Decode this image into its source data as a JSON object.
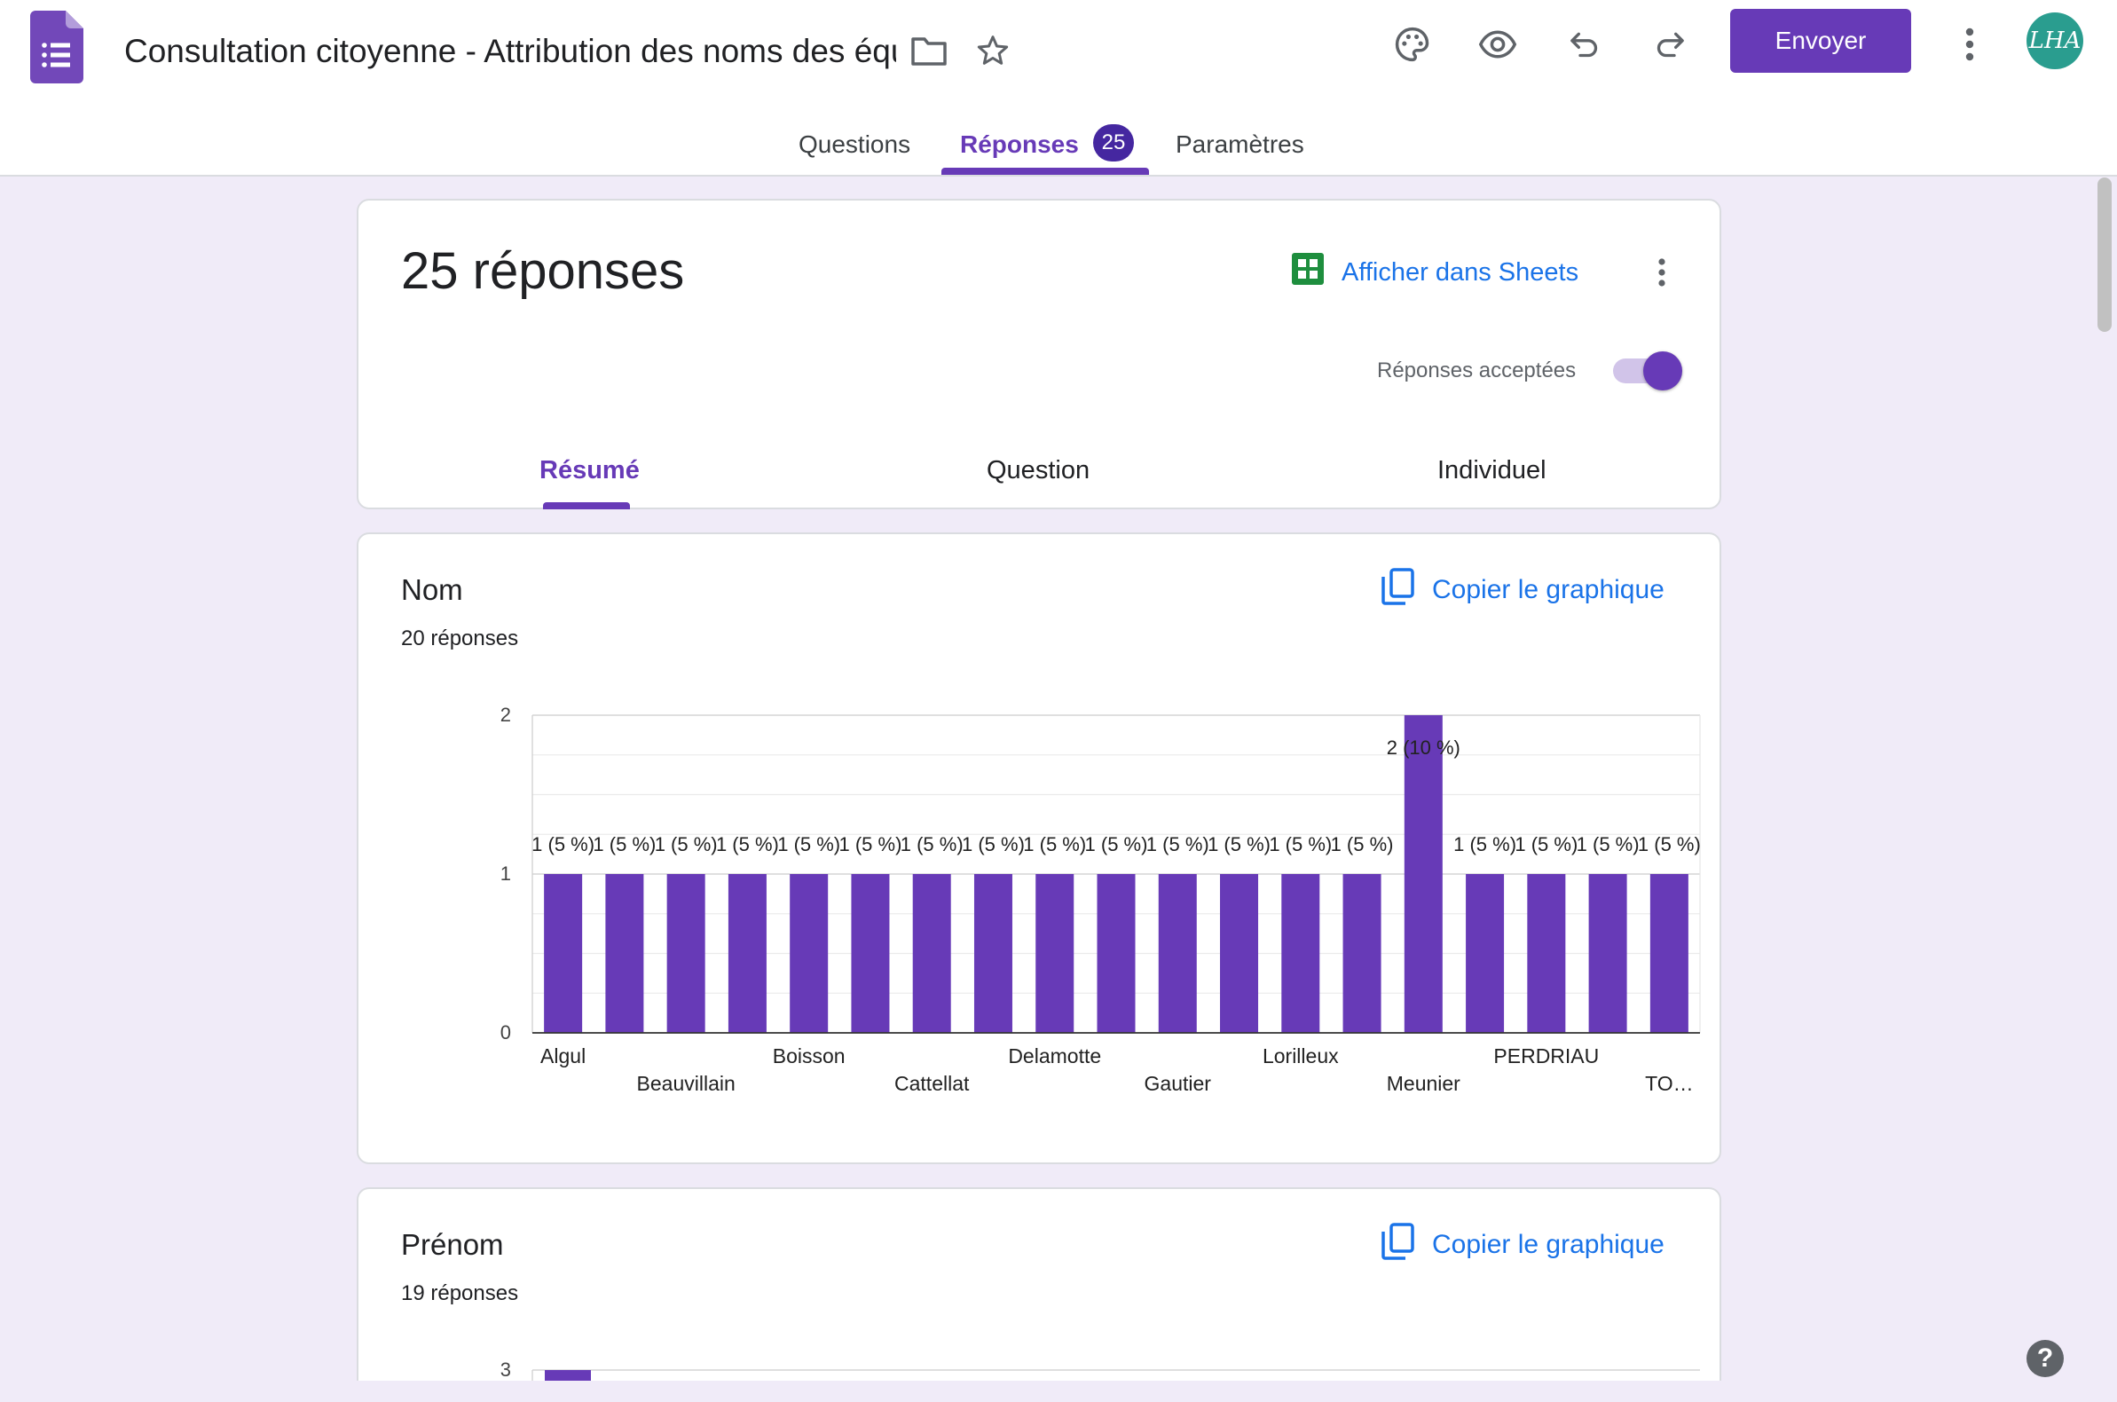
{
  "header": {
    "title": "Consultation citoyenne - Attribution des noms des équipements",
    "send_label": "Envoyer",
    "avatar_text": "LHA"
  },
  "tabs": [
    {
      "label": "Questions"
    },
    {
      "label": "Réponses",
      "badge": "25"
    },
    {
      "label": "Paramètres"
    }
  ],
  "summary": {
    "count_label": "25 réponses",
    "sheets_label": "Afficher dans Sheets",
    "accepting_label": "Réponses acceptées",
    "accepting": true,
    "subtabs": [
      "Résumé",
      "Question",
      "Individuel"
    ]
  },
  "questions": [
    {
      "title": "Nom",
      "count_label": "20 réponses",
      "copy_label": "Copier le graphique"
    },
    {
      "title": "Prénom",
      "count_label": "19 réponses",
      "copy_label": "Copier le graphique"
    }
  ],
  "icons": {
    "accent": "#673ab7",
    "link": "#1a73e8",
    "sheets": "#1e8e3e"
  },
  "chart_data": [
    {
      "type": "bar",
      "ylim": [
        0,
        2
      ],
      "yticks": [
        "0",
        "1",
        "2"
      ],
      "categories": [
        "Algul",
        "Beauvillain",
        "Boisson",
        "Cattellat",
        "Delamotte",
        "Gautier",
        "Lorilleux",
        "Meunier",
        "PERDRIAU",
        "TO…"
      ],
      "values": [
        1,
        1,
        1,
        1,
        1,
        1,
        1,
        1,
        1,
        1,
        1,
        1,
        1,
        1,
        2,
        1,
        1,
        1,
        1
      ],
      "bar_labels": [
        "1 (5 %)",
        "1 (5 %)",
        "1 (5 %)",
        "1 (5 %)",
        "1 (5 %)",
        "1 (5 %)",
        "1 (5 %)",
        "1 (5 %)",
        "1 (5 %)",
        "1 (5 %)",
        "1 (5 %)",
        "1 (5 %)",
        "1 (5 %)",
        "1 (5 %)",
        "2 (10 %)",
        "1 (5 %)",
        "1 (5 %)",
        "1 (5 %)",
        "1 (5 %)"
      ],
      "grid": true,
      "color": "#673ab7"
    },
    {
      "type": "bar",
      "yticks": [
        "3"
      ],
      "grid": true,
      "color": "#673ab7"
    }
  ]
}
